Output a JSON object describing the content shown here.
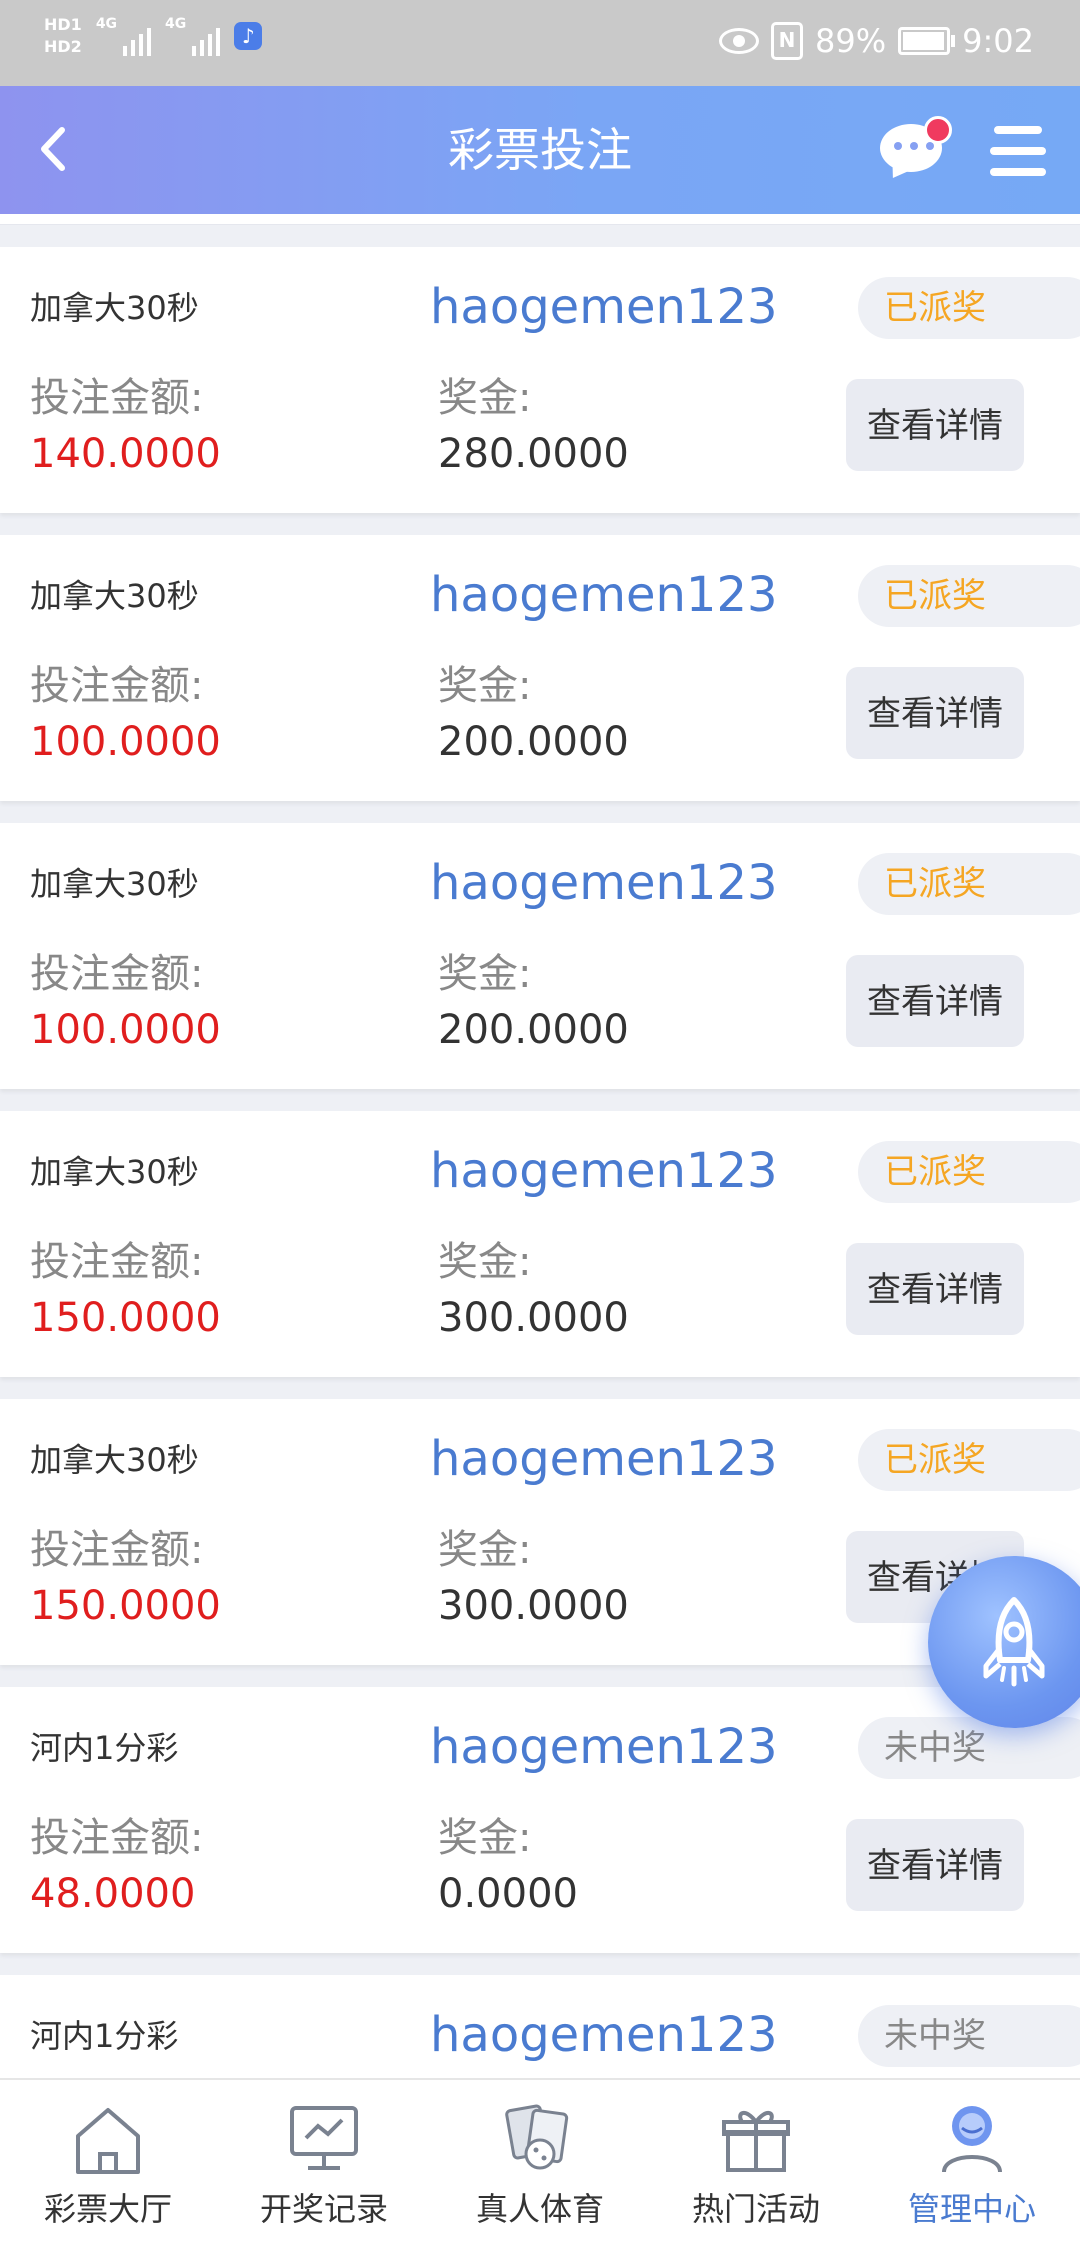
{
  "status_bar": {
    "hd1": "HD1",
    "hd2": "HD2",
    "net1": "4G",
    "net2": "4G",
    "battery_percent": "89%",
    "battery_level": 0.89,
    "time": "9:02"
  },
  "header": {
    "title": "彩票投注",
    "back_icon": "chevron-left-icon",
    "chat_icon": "chat-bubble-icon",
    "menu_icon": "hamburger-menu-icon"
  },
  "labels": {
    "bet_amount": "投注金额:",
    "prize": "奖金:",
    "details_button": "查看详情"
  },
  "bets": [
    {
      "lottery": "加拿大30秒",
      "user": "haogemen123",
      "status": "已派奖",
      "status_type": "paid",
      "amount": "140.0000",
      "prize": "280.0000"
    },
    {
      "lottery": "加拿大30秒",
      "user": "haogemen123",
      "status": "已派奖",
      "status_type": "paid",
      "amount": "100.0000",
      "prize": "200.0000"
    },
    {
      "lottery": "加拿大30秒",
      "user": "haogemen123",
      "status": "已派奖",
      "status_type": "paid",
      "amount": "100.0000",
      "prize": "200.0000"
    },
    {
      "lottery": "加拿大30秒",
      "user": "haogemen123",
      "status": "已派奖",
      "status_type": "paid",
      "amount": "150.0000",
      "prize": "300.0000"
    },
    {
      "lottery": "加拿大30秒",
      "user": "haogemen123",
      "status": "已派奖",
      "status_type": "paid",
      "amount": "150.0000",
      "prize": "300.0000"
    },
    {
      "lottery": "河内1分彩",
      "user": "haogemen123",
      "status": "未中奖",
      "status_type": "lost",
      "amount": "48.0000",
      "prize": "0.0000"
    },
    {
      "lottery": "河内1分彩",
      "user": "haogemen123",
      "status": "未中奖",
      "status_type": "lost",
      "amount": "",
      "prize": ""
    }
  ],
  "bottom_nav": [
    {
      "label": "彩票大厅",
      "icon": "home-icon",
      "active": false
    },
    {
      "label": "开奖记录",
      "icon": "monitor-chart-icon",
      "active": false
    },
    {
      "label": "真人体育",
      "icon": "cards-dice-icon",
      "active": false
    },
    {
      "label": "热门活动",
      "icon": "gift-icon",
      "active": false
    },
    {
      "label": "管理中心",
      "icon": "user-center-icon",
      "active": true
    }
  ],
  "colors": {
    "accent": "#4a7bd0",
    "amount_red": "#e01e1e",
    "paid_orange": "#f5a623"
  }
}
